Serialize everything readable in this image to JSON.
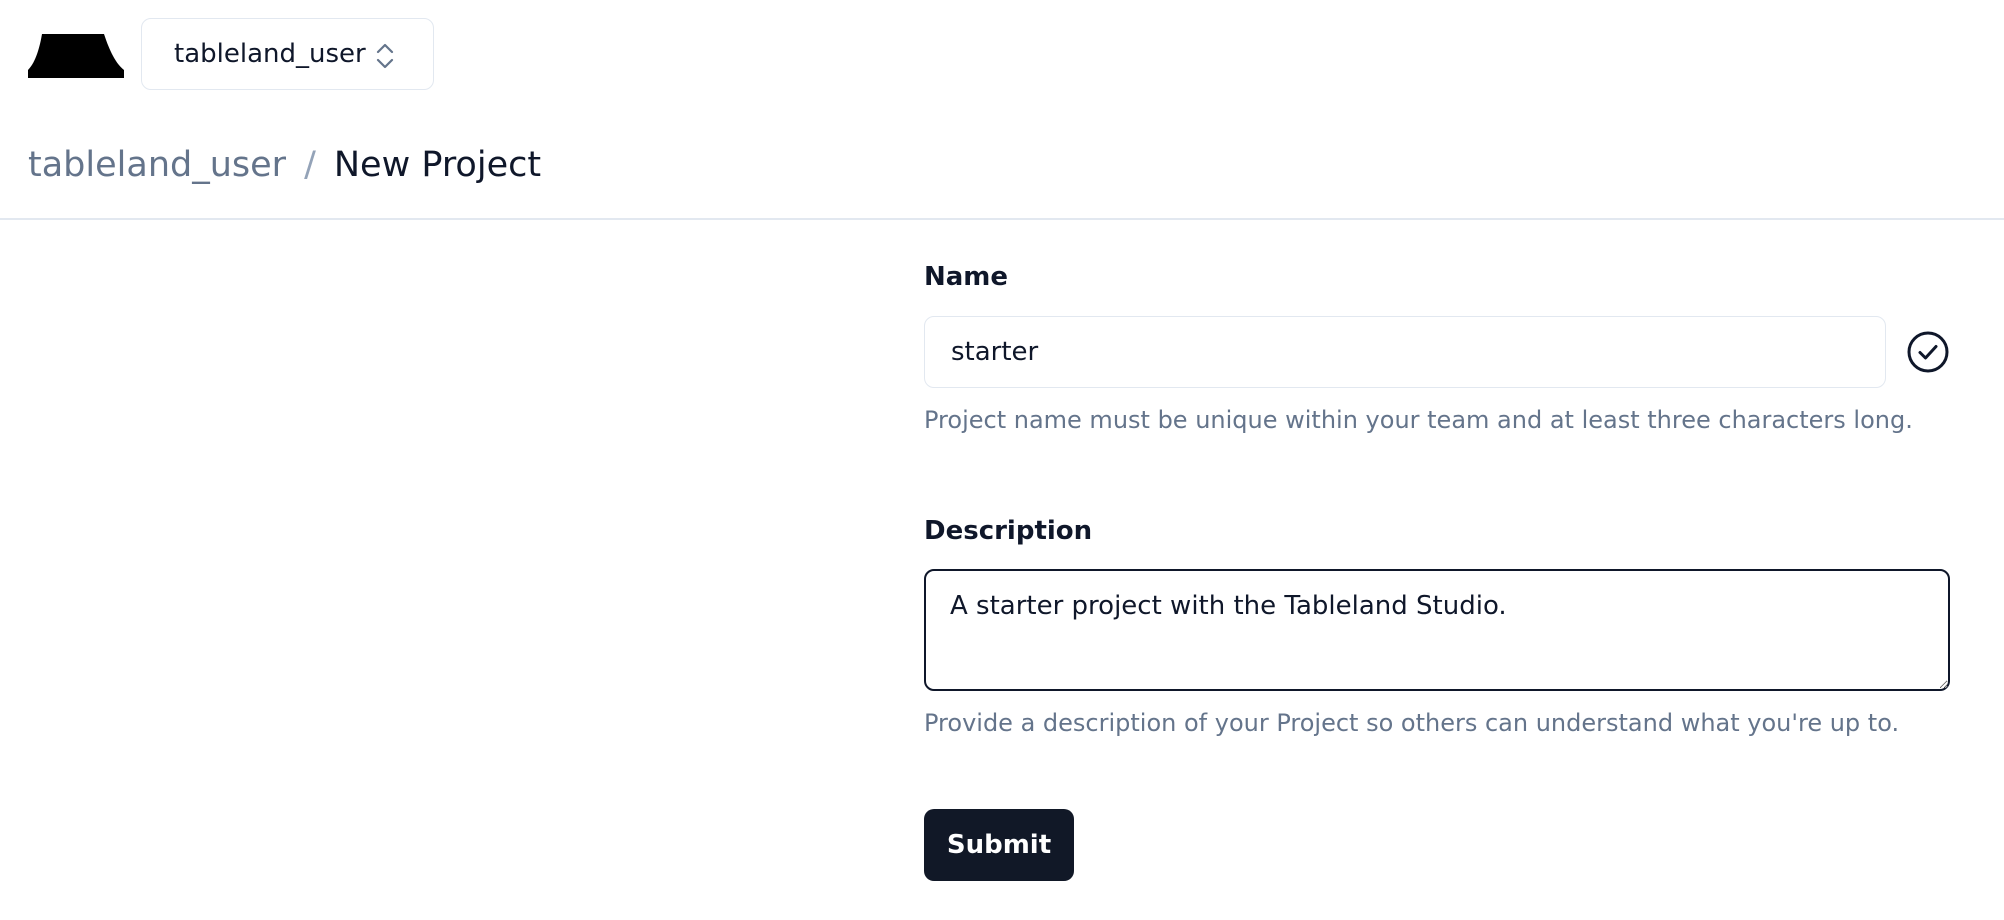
{
  "header": {
    "logo_icon": "tableland-logo-icon",
    "team_switcher": {
      "selected_team": "tableland_user",
      "icon": "chevrons-up-down-icon"
    }
  },
  "breadcrumb": {
    "team": "tableland_user",
    "separator": "/",
    "current": "New Project"
  },
  "form": {
    "name": {
      "label": "Name",
      "value": "starter",
      "hint": "Project name must be unique within your team and at least three characters long.",
      "status_icon": "check-circle-icon"
    },
    "description": {
      "label": "Description",
      "value": "A starter project with the Tableland Studio.",
      "hint": "Provide a description of your Project so others can understand what you're up to."
    },
    "submit_label": "Submit"
  },
  "colors": {
    "text_primary": "#0f172a",
    "text_muted": "#64748b",
    "border": "#e2e8f0",
    "button_bg": "#111827",
    "button_text": "#ffffff"
  }
}
